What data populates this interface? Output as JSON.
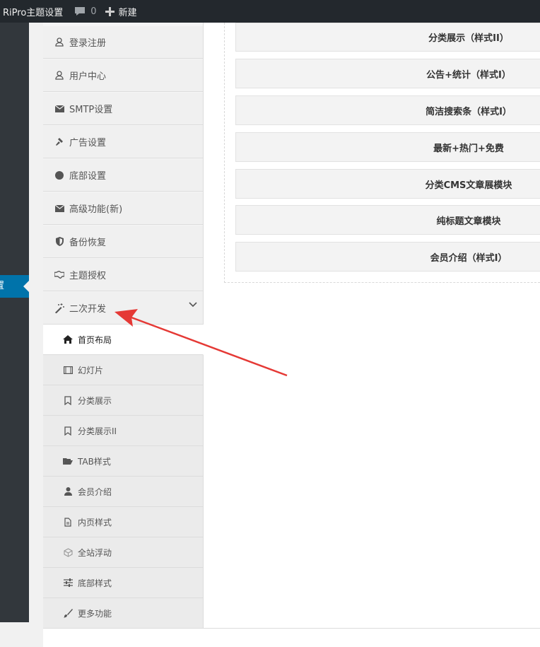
{
  "adminbar": {
    "site_title": "RiPro主题设置",
    "comments_count": "0",
    "new_label": "新建"
  },
  "wpmenu": {
    "current_label": "置"
  },
  "nav": {
    "items": [
      {
        "label": "登录注册",
        "icon": "user-icon"
      },
      {
        "label": "用户中心",
        "icon": "user-icon"
      },
      {
        "label": "SMTP设置",
        "icon": "envelope-icon"
      },
      {
        "label": "广告设置",
        "icon": "gavel-icon"
      },
      {
        "label": "底部设置",
        "icon": "circle-icon"
      },
      {
        "label": "高级功能(新)",
        "icon": "envelope-icon"
      },
      {
        "label": "备份恢复",
        "icon": "shield-icon"
      },
      {
        "label": "主题授权",
        "icon": "handshake-icon"
      },
      {
        "label": "二次开发",
        "icon": "magic-wand-icon"
      }
    ],
    "subitems": [
      {
        "label": "首页布局",
        "icon": "home-icon"
      },
      {
        "label": "幻灯片",
        "icon": "film-icon"
      },
      {
        "label": "分类展示",
        "icon": "bookmark-icon"
      },
      {
        "label": "分类展示II",
        "icon": "bookmark-icon"
      },
      {
        "label": "TAB样式",
        "icon": "folder-open-icon"
      },
      {
        "label": "会员介绍",
        "icon": "user-solid-icon"
      },
      {
        "label": "内页样式",
        "icon": "file-text-icon"
      },
      {
        "label": "全站浮动",
        "icon": "cube-icon"
      },
      {
        "label": "底部样式",
        "icon": "sliders-icon"
      },
      {
        "label": "更多功能",
        "icon": "brush-icon"
      }
    ]
  },
  "modules": [
    "分类展示（样式II）",
    "公告+统计（样式Ⅰ）",
    "简洁搜索条（样式Ⅰ）",
    "最新+热门+免费",
    "分类CMS文章展模块",
    "纯标题文章模块",
    "会员介绍（样式Ⅰ）"
  ],
  "colors": {
    "adminbar_bg": "#23282d",
    "wp_menu_bg": "#32373c",
    "wp_current": "#0073aa",
    "annotation_arrow": "#e53935"
  }
}
